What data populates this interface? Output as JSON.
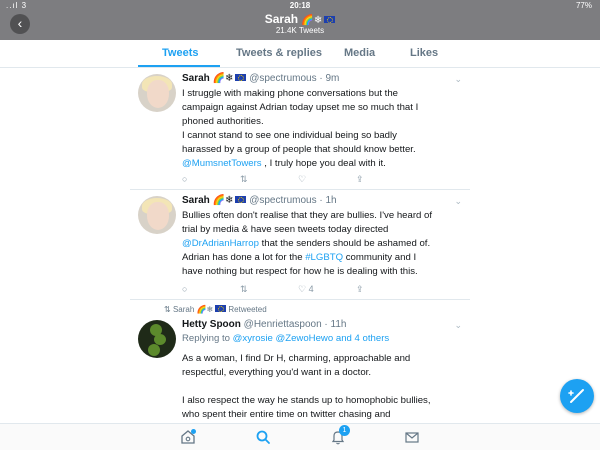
{
  "status_bar": {
    "carrier": "..ıl 3",
    "time": "20:18",
    "battery": "77%"
  },
  "header": {
    "back_icon": "chevron-left-icon",
    "name": "Sarah",
    "emoji": "🌈❄",
    "tweet_count": "21.4K Tweets"
  },
  "tabs": [
    {
      "label": "Tweets",
      "active": true
    },
    {
      "label": "Tweets & replies",
      "active": false
    },
    {
      "label": "Media",
      "active": false
    },
    {
      "label": "Likes",
      "active": false
    }
  ],
  "tweets": [
    {
      "name": "Sarah",
      "emoji": "🌈❄",
      "handle": "@spectrumous · 9m",
      "lines": [
        "I struggle with making phone conversations but the",
        "campaign against Adrian today upset me so much that I",
        "phoned authorities.",
        "I cannot stand to see one individual being so badly",
        "harassed by a group of people that should know better."
      ],
      "mention": "@MumsnetTowers",
      "mention_rest": " , I truly hope you deal with it."
    },
    {
      "name": "Sarah",
      "emoji": "🌈❄",
      "handle": "@spectrumous · 1h",
      "line1": "Bullies often don't realise that they are bullies. I've heard of",
      "line2": "trial by media & have seen tweets today directed",
      "mention": "@DrAdrianHarrop",
      "line3_rest": " that the senders should be ashamed of.",
      "line4_pre": "Adrian has done a lot for the ",
      "hashtag": "#LGBTQ",
      "line4_post": " community and I",
      "line5": "have nothing but respect for how he is dealing with this.",
      "likes": "4"
    },
    {
      "retweeted_by": "Sarah 🌈❄",
      "retweeted_label": "Retweeted",
      "name": "Hetty Spoon",
      "handle": "@Henriettaspoon · 11h",
      "replying_prefix": "Replying to ",
      "replying_to": "@xyrosie @ZewoHewo and 4 others",
      "lines": [
        "As a woman, I find Dr H, charming, approachable and",
        "respectful, everything you'd want in a doctor.",
        "",
        "I also respect the way he stands up to homophobic bullies,",
        "who spent their entire time on twitter chasing and"
      ]
    }
  ],
  "bottom_nav": {
    "icons": [
      "home-icon",
      "search-icon",
      "notifications-icon",
      "messages-icon"
    ],
    "notification_count": "1"
  },
  "colors": {
    "accent": "#1da1f2",
    "header_bg": "#7d7d80"
  },
  "fab_icon": "compose-tweet-icon"
}
